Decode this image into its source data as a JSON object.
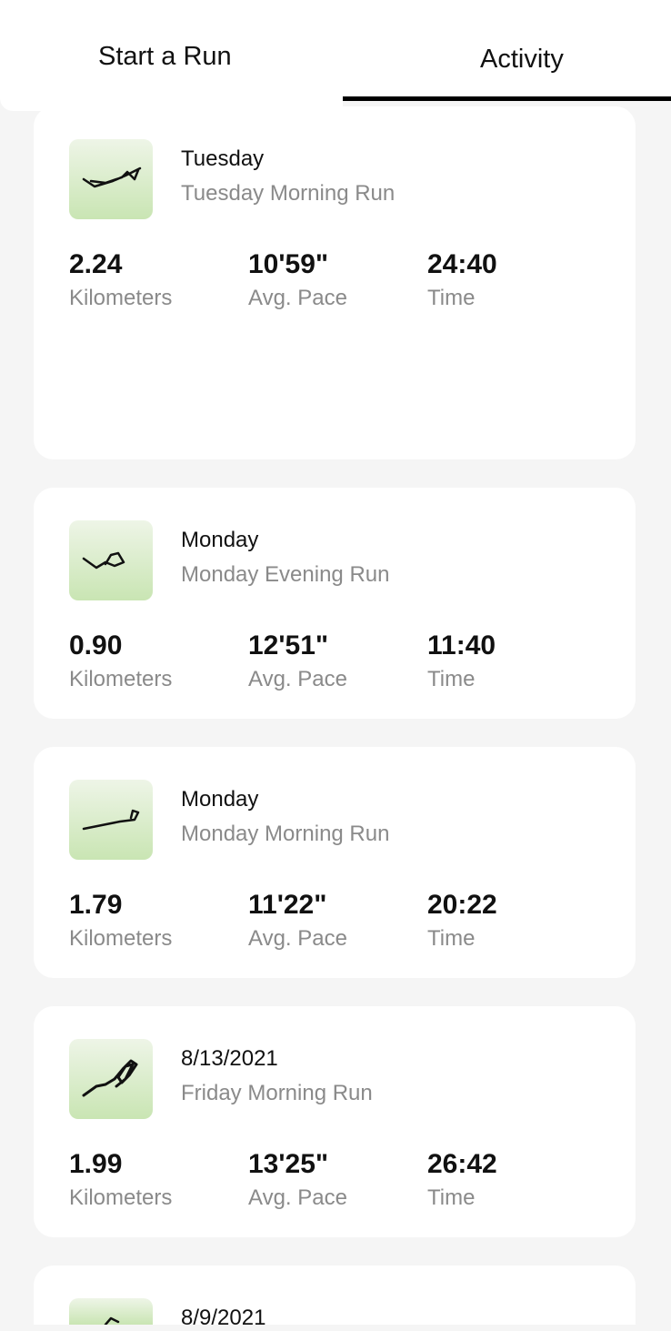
{
  "tabs": {
    "start_run": "Start a Run",
    "activity": "Activity"
  },
  "runs": [
    {
      "day": "Tuesday",
      "title": "Tuesday Morning Run",
      "distance": "2.24",
      "distance_label": "Kilometers",
      "pace": "10'59\"",
      "pace_label": "Avg. Pace",
      "time": "24:40",
      "time_label": "Time"
    },
    {
      "day": "Monday",
      "title": "Monday Evening Run",
      "distance": "0.90",
      "distance_label": "Kilometers",
      "pace": "12'51\"",
      "pace_label": "Avg. Pace",
      "time": "11:40",
      "time_label": "Time"
    },
    {
      "day": "Monday",
      "title": "Monday Morning Run",
      "distance": "1.79",
      "distance_label": "Kilometers",
      "pace": "11'22\"",
      "pace_label": "Avg. Pace",
      "time": "20:22",
      "time_label": "Time"
    },
    {
      "day": "8/13/2021",
      "title": "Friday Morning Run",
      "distance": "1.99",
      "distance_label": "Kilometers",
      "pace": "13'25\"",
      "pace_label": "Avg. Pace",
      "time": "26:42",
      "time_label": "Time"
    },
    {
      "day": "8/9/2021"
    }
  ],
  "icons": {
    "route_map": "route-map-icon"
  },
  "colors": {
    "thumb_top": "#eef5e7",
    "thumb_bottom": "#c9e5b3",
    "active_tab_underline": "#000000"
  }
}
